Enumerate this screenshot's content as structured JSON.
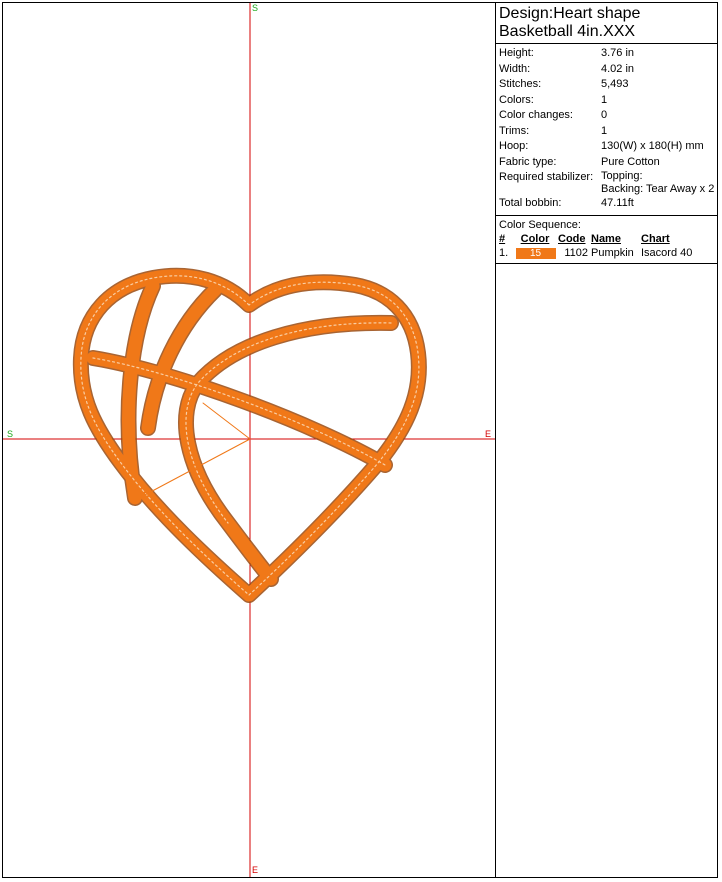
{
  "canvas": {
    "axis_labels": {
      "top": "S",
      "left": "S",
      "right": "E",
      "bottom": "E"
    },
    "colors": {
      "crosshair": "#d40000",
      "stitch": "#f07818",
      "stitch_shade": "#9a4a10",
      "axis_label_top_left": "#1aa81a",
      "axis_label_right_bottom": "#d40000"
    },
    "design_icon": "heart-basketball-design"
  },
  "design": {
    "title_line1": "Design:Heart shape",
    "title_line2": "Basketball 4in.XXX"
  },
  "specs": {
    "height_label": "Height:",
    "height": "3.76 in",
    "width_label": "Width:",
    "width": "4.02 in",
    "stitches_label": "Stitches:",
    "stitches": "5,493",
    "colors_label": "Colors:",
    "colors": "1",
    "color_changes_label": "Color changes:",
    "color_changes": "0",
    "trims_label": "Trims:",
    "trims": "1",
    "hoop_label": "Hoop:",
    "hoop": "130(W) x 180(H) mm",
    "fabric_label": "Fabric type:",
    "fabric": "Pure Cotton",
    "stabilizer_label": "Required stabilizer:",
    "stabilizer_topping": "Topping:",
    "stabilizer_backing": "Backing: Tear Away x 2",
    "bobbin_label": "Total bobbin:",
    "bobbin": "47.11ft"
  },
  "color_sequence": {
    "title": "Color Sequence:",
    "headers": {
      "num": "#",
      "color": "Color",
      "code": "Code",
      "name": "Name",
      "chart": "Chart"
    },
    "rows": [
      {
        "num": "1.",
        "swatch_label": "15",
        "swatch_color": "#f07818",
        "code": "1102",
        "name": "Pumpkin",
        "chart": "Isacord 40"
      }
    ]
  }
}
